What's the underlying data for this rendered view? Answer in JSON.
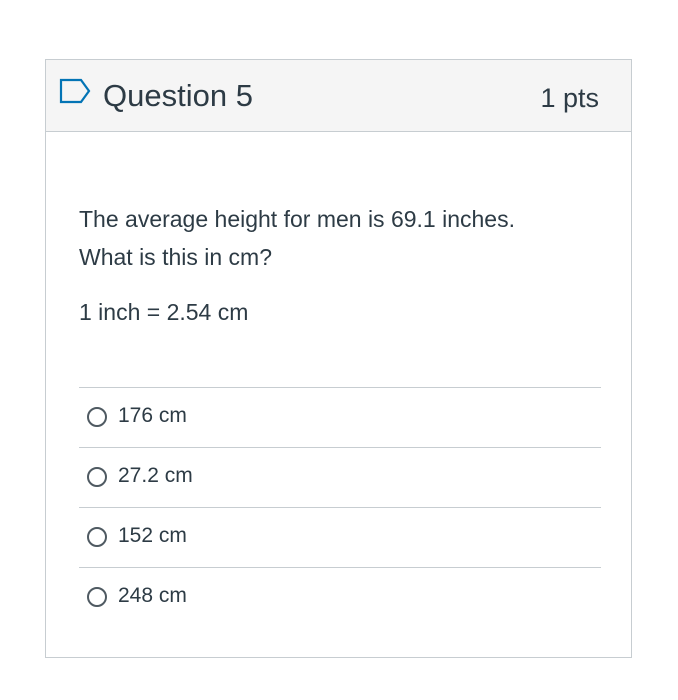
{
  "question": {
    "title": "Question 5",
    "points": "1 pts",
    "flag_icon": "flag-outline-icon",
    "text_line1": "The average height for men is 69.1 inches.",
    "text_line2": "What is this in cm?",
    "conversion": "1 inch = 2.54 cm",
    "selected_answer": null
  },
  "answers": [
    {
      "label": "176 cm",
      "selected": false
    },
    {
      "label": "27.2 cm",
      "selected": false
    },
    {
      "label": "152 cm",
      "selected": false
    },
    {
      "label": "248 cm",
      "selected": false
    }
  ],
  "colors": {
    "text": "#2d3b45",
    "header_bg": "#f5f5f5",
    "border": "#c7cdd1",
    "flag": "#0374b5"
  }
}
